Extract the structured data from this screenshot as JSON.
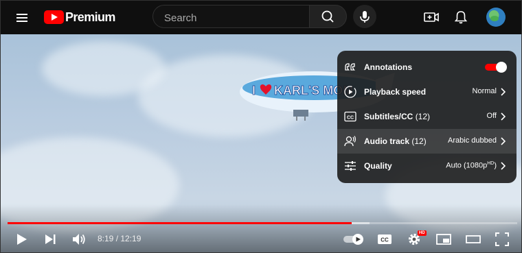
{
  "header": {
    "logo_text": "Premium",
    "search_placeholder": "Search"
  },
  "video_overlay": {
    "banner_text": "KARL'S MOM"
  },
  "settings_menu": {
    "items": [
      {
        "label": "Annotations",
        "count": "",
        "value": "",
        "kind": "toggle",
        "on": true
      },
      {
        "label": "Playback speed",
        "count": "",
        "value": "Normal",
        "kind": "submenu"
      },
      {
        "label": "Subtitles/CC",
        "count": "(12)",
        "value": "Off",
        "kind": "submenu"
      },
      {
        "label": "Audio track",
        "count": "(12)",
        "value": "Arabic dubbed",
        "kind": "submenu",
        "highlighted": true
      },
      {
        "label": "Quality",
        "count": "",
        "value": "Auto (1080p",
        "value_sup": "HD",
        "value_suffix": ")",
        "kind": "submenu"
      }
    ]
  },
  "player": {
    "current_time": "8:19",
    "separator": " / ",
    "duration": "12:19",
    "progress_fraction": 0.675,
    "buffered_fraction": 0.71,
    "hd_badge": "HD"
  },
  "colors": {
    "accent": "#ff0000",
    "header_bg": "#0f0f0f",
    "menu_bg": "#1c1c1c"
  }
}
